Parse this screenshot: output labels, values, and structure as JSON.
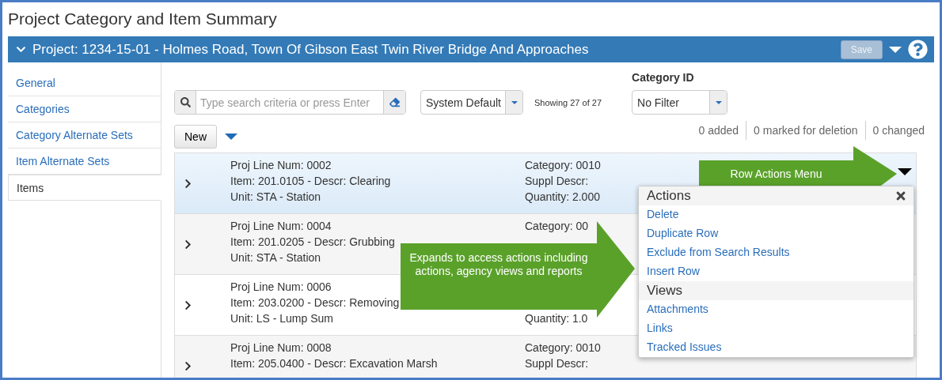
{
  "page_title": "Project Category and Item Summary",
  "project_bar": {
    "title": "Project: 1234-15-01 - Holmes Road, Town Of Gibson East Twin River Bridge And Approaches",
    "save_label": "Save",
    "save_disabled": true
  },
  "sidebar": {
    "items": [
      {
        "label": "General",
        "selected": false
      },
      {
        "label": "Categories",
        "selected": false
      },
      {
        "label": "Category Alternate Sets",
        "selected": false
      },
      {
        "label": "Item Alternate Sets",
        "selected": false
      },
      {
        "label": "Items",
        "selected": true
      }
    ]
  },
  "search": {
    "placeholder": "Type search criteria or press Enter"
  },
  "view_select": {
    "value": "System Default"
  },
  "showing": "Showing 27 of 27",
  "category_filter": {
    "label": "Category ID",
    "value": "No Filter"
  },
  "new_button": "New",
  "counts": [
    "0 added",
    "0 marked for deletion",
    "0 changed"
  ],
  "rows": [
    {
      "selected": true,
      "col1": [
        "Proj Line Num: 0002",
        "Item: 201.0105 - Descr: Clearing",
        "Unit: STA - Station"
      ],
      "col2": {
        "category": "Category: 0010",
        "suppl": "Suppl Descr:",
        "quantity": "Quantity: 2.000"
      }
    },
    {
      "selected": false,
      "col1": [
        "Proj Line Num: 0004",
        "Item: 201.0205 - Descr: Grubbing",
        "Unit: STA - Station"
      ],
      "col2": {
        "category": "Category: 00"
      }
    },
    {
      "selected": false,
      "col1": [
        "Proj Line Num: 0006",
        "Item: 203.0200 - Descr: Removing",
        "Unit: LS - Lump Sum"
      ],
      "col2": {
        "quantity": "Quantity: 1.0"
      }
    },
    {
      "selected": false,
      "col1": [
        "Proj Line Num: 0008",
        "Item: 205.0400 - Descr: Excavation Marsh"
      ],
      "col2": {
        "category": "Category: 0010",
        "suppl": "Suppl Descr:"
      }
    }
  ],
  "row_menu": {
    "sections": [
      {
        "title": "Actions",
        "items": [
          "Delete",
          "Duplicate Row",
          "Exclude from Search Results",
          "Insert Row"
        ]
      },
      {
        "title": "Views",
        "items": [
          "Attachments",
          "Links",
          "Tracked Issues"
        ]
      }
    ]
  },
  "callouts": [
    {
      "text": "Row Actions Menu"
    },
    {
      "text": "Expands to access actions including actions, agency views and reports"
    }
  ]
}
